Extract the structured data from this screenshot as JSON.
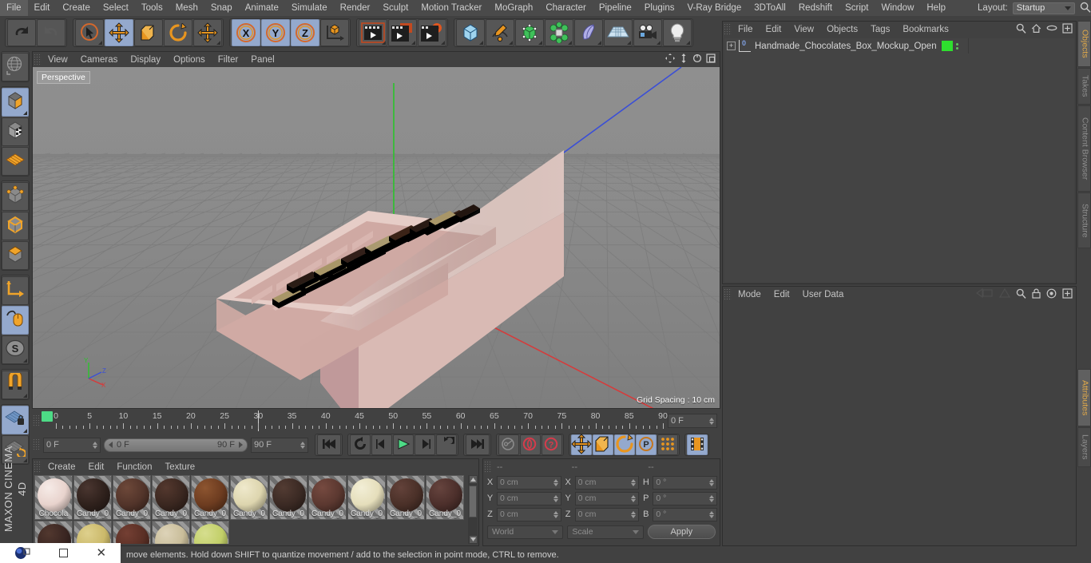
{
  "app": {
    "name": "CINEMA 4D",
    "brand_top": "MAXON",
    "brand_bottom": "CINEMA 4D"
  },
  "menubar": {
    "items": [
      "File",
      "Edit",
      "Create",
      "Select",
      "Tools",
      "Mesh",
      "Snap",
      "Animate",
      "Simulate",
      "Render",
      "Sculpt",
      "Motion Tracker",
      "MoGraph",
      "Character",
      "Pipeline",
      "Plugins",
      "V-Ray Bridge",
      "3DToAll",
      "Redshift",
      "Script",
      "Window",
      "Help"
    ],
    "layout_label": "Layout:",
    "layout_value": "Startup",
    "search_icon": "search-icon"
  },
  "toolbar": {
    "groups": [
      {
        "name": "undo-redo",
        "buttons": [
          {
            "name": "undo-button",
            "icon": "undo-arrow-icon",
            "selected": false
          },
          {
            "name": "redo-button",
            "icon": "redo-arrow-icon",
            "selected": false
          }
        ]
      },
      {
        "name": "transform-tools",
        "buttons": [
          {
            "name": "live-selection-tool",
            "icon": "cursor-circle-icon",
            "selected": false
          },
          {
            "name": "move-tool",
            "icon": "move-arrows-icon",
            "selected": true
          },
          {
            "name": "scale-tool",
            "icon": "scale-box-icon",
            "selected": false
          },
          {
            "name": "rotate-tool",
            "icon": "rotate-arc-icon",
            "selected": false
          },
          {
            "name": "move-extra-tool",
            "icon": "move-arrows-icon",
            "selected": false
          }
        ]
      },
      {
        "name": "axis-locks",
        "buttons": [
          {
            "name": "lock-x-axis",
            "icon": "x-axis-icon",
            "selected": true
          },
          {
            "name": "lock-y-axis",
            "icon": "y-axis-icon",
            "selected": true
          },
          {
            "name": "lock-z-axis",
            "icon": "z-axis-icon",
            "selected": true
          },
          {
            "name": "world-object-coordinates",
            "icon": "world-axis-icon",
            "selected": false
          }
        ]
      },
      {
        "name": "render-tools",
        "buttons": [
          {
            "name": "render-view-button",
            "icon": "render-view-icon",
            "selected": false
          },
          {
            "name": "render-region-button",
            "icon": "render-region-icon",
            "selected": false
          },
          {
            "name": "render-settings-button",
            "icon": "render-settings-icon",
            "selected": false
          }
        ]
      },
      {
        "name": "object-creation",
        "buttons": [
          {
            "name": "add-cube-button",
            "icon": "cube-icon",
            "selected": false
          },
          {
            "name": "add-spline-button",
            "icon": "pen-spline-icon",
            "selected": false
          },
          {
            "name": "add-nurbs-button",
            "icon": "green-cube-icon",
            "selected": false
          },
          {
            "name": "add-array-button",
            "icon": "green-cluster-icon",
            "selected": false
          },
          {
            "name": "add-bend-deformer-button",
            "icon": "bend-deformer-icon",
            "selected": false
          },
          {
            "name": "add-floor-button",
            "icon": "floor-grid-icon",
            "selected": false
          },
          {
            "name": "add-camera-button",
            "icon": "camera-icon",
            "selected": false
          },
          {
            "name": "add-light-button",
            "icon": "light-bulb-icon",
            "selected": false
          }
        ]
      }
    ]
  },
  "left_palette": {
    "groups": [
      {
        "name": "global-local",
        "buttons": [
          {
            "name": "world-coordinates-toggle",
            "icon": "globe-axis-icon",
            "selected": false
          }
        ]
      },
      {
        "name": "object-modes",
        "buttons": [
          {
            "name": "model-mode-button",
            "icon": "model-cube-icon",
            "selected": true
          },
          {
            "name": "texture-mode-button",
            "icon": "texture-cube-icon",
            "selected": false
          },
          {
            "name": "axis-mode-button",
            "icon": "deform-mesh-icon",
            "selected": false
          }
        ]
      },
      {
        "name": "component-modes",
        "buttons": [
          {
            "name": "points-mode-button",
            "icon": "points-cube-icon",
            "selected": false
          },
          {
            "name": "edges-mode-button",
            "icon": "edges-cube-icon",
            "selected": false
          },
          {
            "name": "polygons-mode-button",
            "icon": "polygons-cube-icon",
            "selected": false
          }
        ]
      },
      {
        "name": "workplane",
        "buttons": [
          {
            "name": "enable-axis-button",
            "icon": "axis-l-icon",
            "selected": false
          },
          {
            "name": "enable-snapping-button",
            "icon": "mouse-spline-icon",
            "selected": true
          },
          {
            "name": "soft-selection-button",
            "icon": "s-circle-icon",
            "selected": false
          }
        ]
      },
      {
        "name": "magnet",
        "buttons": [
          {
            "name": "magnet-tool-button",
            "icon": "magnet-icon",
            "selected": false
          }
        ]
      },
      {
        "name": "workplane-lock",
        "buttons": [
          {
            "name": "lock-workplane-button",
            "icon": "grid-lock-icon",
            "selected": true
          },
          {
            "name": "planar-workplane-button",
            "icon": "grid-rotate-icon",
            "selected": false
          }
        ]
      }
    ]
  },
  "viewport": {
    "menu_items": [
      "View",
      "Cameras",
      "Display",
      "Options",
      "Filter",
      "Panel"
    ],
    "view_label": "Perspective",
    "grid_spacing_label": "Grid Spacing : 10 cm",
    "corner_icons": [
      "pan-icon",
      "dolly-icon",
      "orbit-icon",
      "maximize-icon"
    ],
    "axis_gizmo": {
      "y": "Y",
      "z": "Z",
      "x": "X"
    },
    "colors": {
      "background_top": "#8e8e8e",
      "background_bottom": "#7e7e7e",
      "grid_line": "#7a7a7a",
      "axis_y": "#2ac42a",
      "axis_x": "#d63b3b",
      "axis_z": "#3b4fd6",
      "box_face_light": "#e8cec8",
      "box_face_mid": "#dcbdb6",
      "box_face_dark": "#c9a7a1"
    }
  },
  "timeline": {
    "start": 0,
    "end": 90,
    "tick_labels": [
      0,
      5,
      10,
      15,
      20,
      25,
      30,
      35,
      40,
      45,
      50,
      55,
      60,
      65,
      70,
      75,
      80,
      85,
      90
    ],
    "current_frame_field": "0 F"
  },
  "transport": {
    "current_frame": "0 F",
    "range_start": "0 F",
    "range_end": "90 F",
    "preview_end": "90 F",
    "buttons": [
      {
        "name": "go-to-start-button",
        "icon": "skip-start-icon",
        "selected": false
      },
      {
        "name": "play-backwards-button",
        "icon": "loop-back-icon",
        "selected": false
      },
      {
        "name": "previous-frame-button",
        "icon": "step-back-icon",
        "selected": false
      },
      {
        "name": "play-button",
        "icon": "play-icon",
        "selected": false
      },
      {
        "name": "next-frame-button",
        "icon": "step-forward-icon",
        "selected": false
      },
      {
        "name": "loop-button",
        "icon": "loop-forward-icon",
        "selected": false
      },
      {
        "name": "go-to-end-button",
        "icon": "skip-end-icon",
        "selected": false
      },
      {
        "name": "record-key-button",
        "icon": "key-icon",
        "selected": false
      },
      {
        "name": "autokeying-button",
        "icon": "autokey-red-icon",
        "selected": false
      },
      {
        "name": "keying-help-button",
        "icon": "question-red-icon",
        "selected": false
      },
      {
        "name": "key-position-button",
        "icon": "move-arrows-icon",
        "selected": true
      },
      {
        "name": "key-scale-button",
        "icon": "scale-box-icon",
        "selected": true
      },
      {
        "name": "key-rotation-button",
        "icon": "rotate-arc-icon",
        "selected": true
      },
      {
        "name": "key-parameter-button",
        "icon": "p-circle-icon",
        "selected": true
      },
      {
        "name": "key-pla-button",
        "icon": "dots-grid-icon",
        "selected": false
      },
      {
        "name": "timeline-button",
        "icon": "filmstrip-icon",
        "selected": true
      }
    ]
  },
  "materials": {
    "menu_items": [
      "Create",
      "Edit",
      "Function",
      "Texture"
    ],
    "items": [
      {
        "label": "Chocola",
        "color": "#e8d3cd",
        "highlight": "#f6ebe7"
      },
      {
        "label": "Candy_0",
        "color": "#2f211c",
        "highlight": "#4a3630"
      },
      {
        "label": "Candy_0",
        "color": "#52342a",
        "highlight": "#6d4839"
      },
      {
        "label": "Candy_0",
        "color": "#3a2720",
        "highlight": "#54382e"
      },
      {
        "label": "Candy_0",
        "color": "#6d3c20",
        "highlight": "#8d5530"
      },
      {
        "label": "Candy_0",
        "color": "#ddd5ae",
        "highlight": "#efe9cc"
      },
      {
        "label": "Candy_0",
        "color": "#3b2a24",
        "highlight": "#533c33"
      },
      {
        "label": "Candy_0",
        "color": "#5b3830",
        "highlight": "#764a40"
      },
      {
        "label": "Candy_0",
        "color": "#e5debb",
        "highlight": "#f2eed6"
      },
      {
        "label": "Candy_0",
        "color": "#4a3028",
        "highlight": "#63423a"
      },
      {
        "label": "Candy_0",
        "color": "#4c2f2b",
        "highlight": "#66443e"
      },
      {
        "label": "",
        "color": "#3a2622",
        "highlight": "#52382f"
      },
      {
        "label": "",
        "color": "#cbb96a",
        "highlight": "#ded08d"
      },
      {
        "label": "",
        "color": "#5a2f25",
        "highlight": "#743f33"
      },
      {
        "label": "",
        "color": "#c9bd9a",
        "highlight": "#ddd3b8"
      },
      {
        "label": "",
        "color": "#c2cf68",
        "highlight": "#d6de8f"
      }
    ]
  },
  "coordinates": {
    "head_cells": [
      "--",
      "--",
      "--"
    ],
    "rows": [
      {
        "pos_label": "X",
        "pos_value": "0 cm",
        "size_label": "X",
        "size_value": "0 cm",
        "rot_label": "H",
        "rot_value": "0 °"
      },
      {
        "pos_label": "Y",
        "pos_value": "0 cm",
        "size_label": "Y",
        "size_value": "0 cm",
        "rot_label": "P",
        "rot_value": "0 °"
      },
      {
        "pos_label": "Z",
        "pos_value": "0 cm",
        "size_label": "Z",
        "size_value": "0 cm",
        "rot_label": "B",
        "rot_value": "0 °"
      }
    ],
    "space_select": "World",
    "mode_select": "Scale",
    "apply_button": "Apply"
  },
  "objects_panel": {
    "menu_items": [
      "File",
      "Edit",
      "View",
      "Objects",
      "Tags",
      "Bookmarks"
    ],
    "header_icons": [
      "search-icon",
      "home-icon",
      "ellipse-icon",
      "add-layer-icon"
    ],
    "items": [
      {
        "name": "Handmade_Chocolates_Box_Mockup_Open",
        "layer_color": "#2ee02e",
        "badge": "0"
      }
    ]
  },
  "attributes_panel": {
    "menu_items": [
      "Mode",
      "Edit",
      "User Data"
    ],
    "header_icons": [
      "back-arrow-icon",
      "forward-arrow-icon",
      "search-icon",
      "lock-icon",
      "target-icon",
      "add-icon"
    ]
  },
  "tabstrip": {
    "tabs": [
      {
        "label": "Objects",
        "active": true
      },
      {
        "label": "Takes",
        "active": false
      },
      {
        "label": "Content Browser",
        "active": false
      },
      {
        "label": "Structure",
        "active": false
      },
      {
        "label": "Attributes",
        "active": true
      },
      {
        "label": "Layers",
        "active": false
      }
    ]
  },
  "statusbar": {
    "text": "move elements. Hold down SHIFT to quantize movement / add to the selection in point mode, CTRL to remove."
  },
  "taskbar": {
    "icons": [
      "app-orb-icon",
      "restore-window-icon",
      "minimize-icon",
      "close-icon"
    ]
  }
}
